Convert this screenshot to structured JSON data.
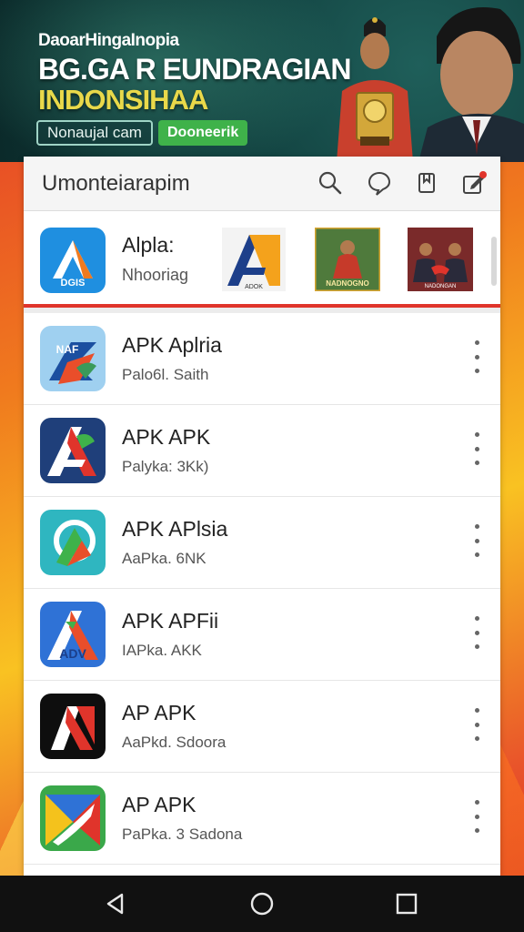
{
  "banner": {
    "pre_title": "DaoarHingaInopia",
    "title_line1": "BG.GA R EUNDRAGIAN",
    "title_line2": "INDONSIHAA",
    "button_left": "Nonaujal cam",
    "button_right": "Dooneerik"
  },
  "toolbar": {
    "title": "Umonteiarapim",
    "icons": [
      "search-icon",
      "chat-icon",
      "bookmark-icon",
      "edit-icon"
    ]
  },
  "featured": {
    "name": "Alpla:",
    "subtitle": "Nhooriag",
    "icon_label": "DGIS",
    "tile_labels": [
      "ADOK",
      "NADNOGNO",
      "NADONGAN"
    ]
  },
  "apps": [
    {
      "name": "APK Aplria",
      "subtitle": "Palo6l. Saith",
      "icon_label": "NAF"
    },
    {
      "name": "APK APK",
      "subtitle": "Palyka: 3Kk)",
      "icon_label": ""
    },
    {
      "name": "APK APlsia",
      "subtitle": "AaPka. 6NK",
      "icon_label": ""
    },
    {
      "name": "APK APFii",
      "subtitle": "IAPka. AKK",
      "icon_label": "ADV"
    },
    {
      "name": "AP APK",
      "subtitle": "AaPkd. Sdoora",
      "icon_label": ""
    },
    {
      "name": "AP APK",
      "subtitle": "PaPka. 3 Sadona",
      "icon_label": ""
    }
  ],
  "navbar": {
    "icons": [
      "back-icon",
      "home-icon",
      "recents-icon"
    ]
  },
  "colors": {
    "accent_red": "#e0342b",
    "banner_green": "#3fb24a",
    "title_yellow": "#e9d94a"
  }
}
